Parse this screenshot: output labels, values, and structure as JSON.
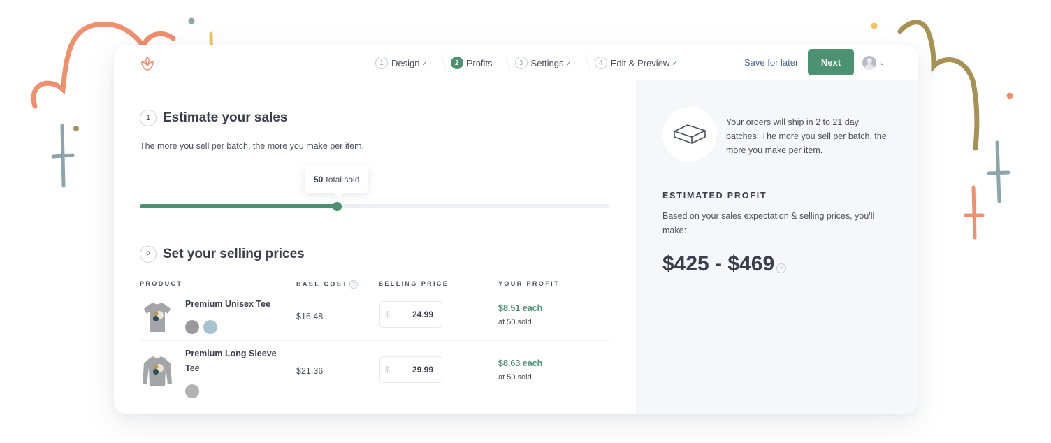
{
  "header": {
    "steps": [
      {
        "number": "1",
        "label": "Design",
        "completed": true,
        "active": false
      },
      {
        "number": "2",
        "label": "Profits",
        "completed": false,
        "active": true
      },
      {
        "number": "3",
        "label": "Settings",
        "completed": true,
        "active": false
      },
      {
        "number": "4",
        "label": "Edit & Preview",
        "completed": true,
        "active": false
      }
    ],
    "check_glyph": "✓",
    "save_for_later": "Save for later",
    "next": "Next",
    "caret_glyph": "⌄"
  },
  "estimate": {
    "number": "1",
    "title": "Estimate your sales",
    "description": "The more you sell per batch, the more you make per item.",
    "tooltip_value": "50",
    "tooltip_suffix": "total sold",
    "slider_fraction": 0.42
  },
  "pricing": {
    "number": "2",
    "title": "Set your selling prices",
    "columns": {
      "product": "PRODUCT",
      "base_cost": "BASE COST",
      "selling_price": "SELLING PRICE",
      "your_profit": "YOUR PROFIT"
    },
    "info_glyph": "?",
    "currency_symbol": "$",
    "products": [
      {
        "name": "Premium Unisex Tee",
        "base_cost": "$16.48",
        "selling_price": "24.99",
        "profit": "$8.51 each",
        "profit_note": "at 50 sold",
        "colors": [
          "#9a9a9c",
          "#a9c2cf"
        ]
      },
      {
        "name": "Premium Long Sleeve Tee",
        "base_cost": "$21.36",
        "selling_price": "29.99",
        "profit": "$8.63 each",
        "profit_note": "at 50 sold",
        "colors": [
          "#b2b2b4"
        ]
      }
    ]
  },
  "summary": {
    "ship_text": "Your orders will ship in 2 to 21 day batches. The more you sell per batch, the more you make per item.",
    "estimated_label": "ESTIMATED PROFIT",
    "estimated_desc": "Based on your sales expectation & selling prices, you'll make:",
    "estimated_value": "$425 - $469"
  },
  "colors": {
    "accent": "#4c9172",
    "link": "#4b6a94",
    "panel": "#f5f7fa"
  }
}
